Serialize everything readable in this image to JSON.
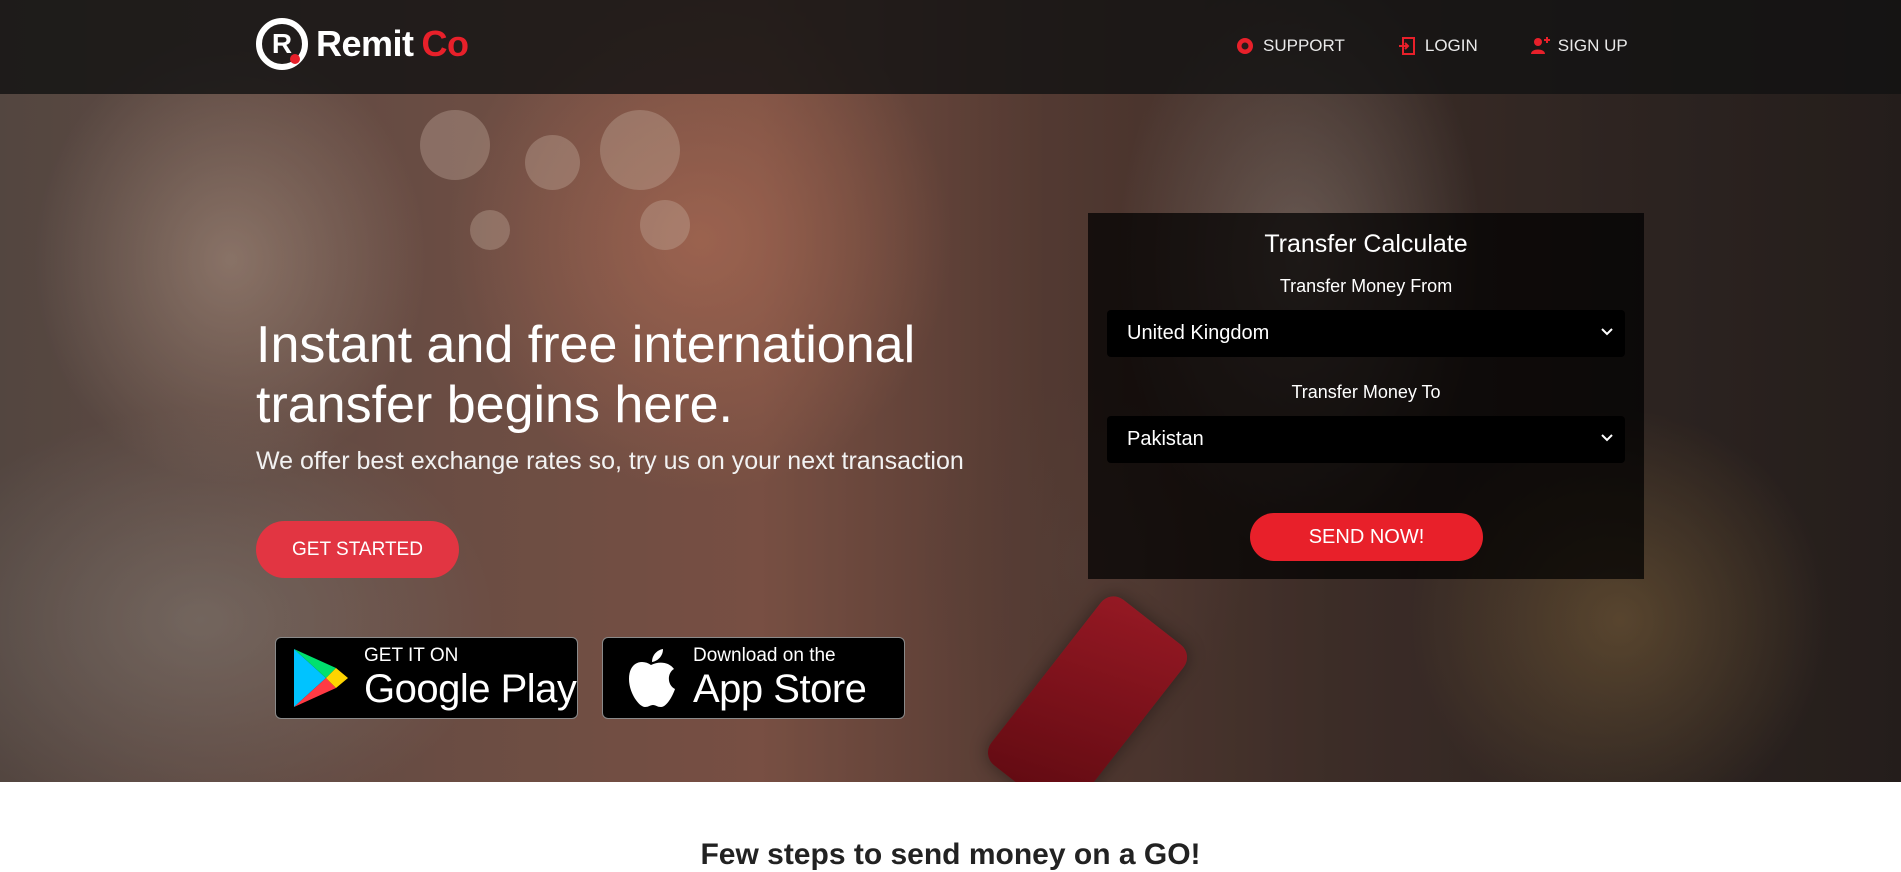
{
  "brand": {
    "name_part1": "Remit",
    "name_part2": "Co",
    "mark_letter": "R",
    "accent_color": "#e8202a"
  },
  "nav": {
    "items": [
      {
        "label": "SUPPORT",
        "icon": "support-icon"
      },
      {
        "label": "LOGIN",
        "icon": "login-icon"
      },
      {
        "label": "SIGN UP",
        "icon": "add-user-icon"
      }
    ]
  },
  "hero": {
    "headline": "Instant and free international transfer begins here.",
    "subheadline": "We offer best exchange rates so, try us on your next transaction",
    "cta_label": "GET STARTED",
    "cta_color": "#e23542"
  },
  "badges": {
    "google_play": {
      "small": "GET IT ON",
      "big": "Google Play",
      "icon": "google-play-icon"
    },
    "app_store": {
      "small": "Download on the",
      "big": "App Store",
      "icon": "apple-icon"
    }
  },
  "calculator": {
    "title": "Transfer Calculate",
    "from_label": "Transfer Money From",
    "from_value": "United Kingdom",
    "to_label": "Transfer Money To",
    "to_value": "Pakistan",
    "send_label": "SEND NOW!"
  },
  "section": {
    "title": "Few steps to send money on a GO!"
  }
}
